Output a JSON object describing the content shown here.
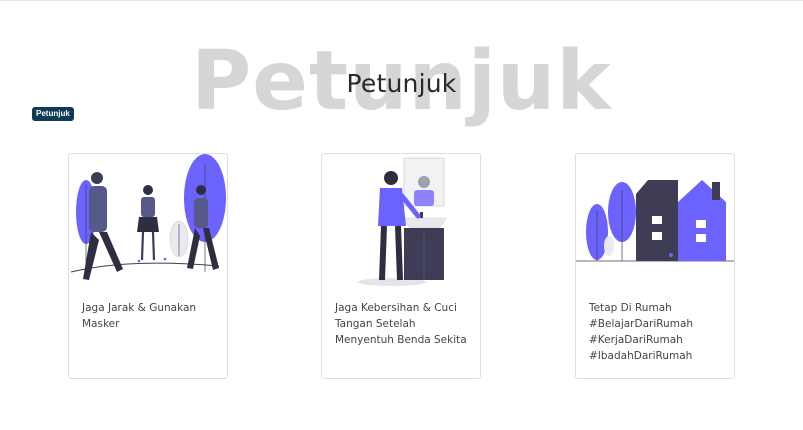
{
  "section": {
    "background_title": "Petunjuk",
    "title": "Petunjuk",
    "badge": "Petunjuk"
  },
  "cards": [
    {
      "illustration": "people-walking-with-masks",
      "lines": [
        "Jaga Jarak & Gunakan",
        "Masker"
      ]
    },
    {
      "illustration": "man-washing-hands-at-sink",
      "lines": [
        "Jaga Kebersihan & Cuci",
        "Tangan Setelah",
        "Menyentuh Benda Sekita"
      ]
    },
    {
      "illustration": "house-with-trees",
      "lines": [
        "Tetap Di Rumah",
        "#BelajarDariRumah",
        "#KerjaDariRumah",
        "#IbadahDariRumah"
      ]
    }
  ],
  "colors": {
    "accent": "#6c63ff",
    "dark": "#3f3d56",
    "badge": "#0f3b55",
    "ghost_title": "#d6d6d6"
  }
}
